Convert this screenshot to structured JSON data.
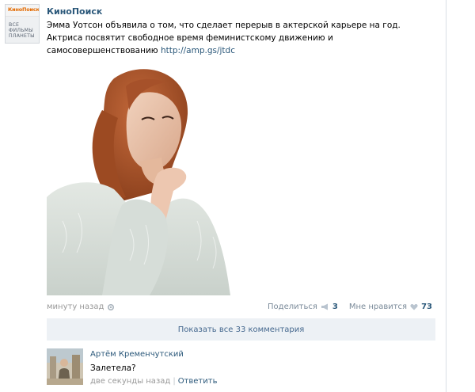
{
  "post": {
    "author": "КиноПоиск",
    "logo_brand": "КиноПоиск",
    "logo_tagline": "ВСЕ ФИЛЬМЫ ПЛАНЕТЫ",
    "text": "Эмма Уотсон объявила о том, что сделает перерыв в актерской карьере на год. Актриса посвятит свободное время феминистскому движению и самосовершенствованию",
    "link": "http://amp.gs/jtdc",
    "time": "минуту назад",
    "share_label": "Поделиться",
    "share_count": "3",
    "like_label": "Мне нравится",
    "like_count": "73",
    "show_all_comments": "Показать все 33 комментария"
  },
  "comment": {
    "author": "Артём Кременчутский",
    "text": "Залетела?",
    "time": "две секунды назад",
    "reply_label": "Ответить"
  },
  "colors": {
    "link": "#2b587a",
    "meta": "#999999",
    "show_all_bg": "#edf1f5",
    "brand_orange": "#e36a00"
  }
}
